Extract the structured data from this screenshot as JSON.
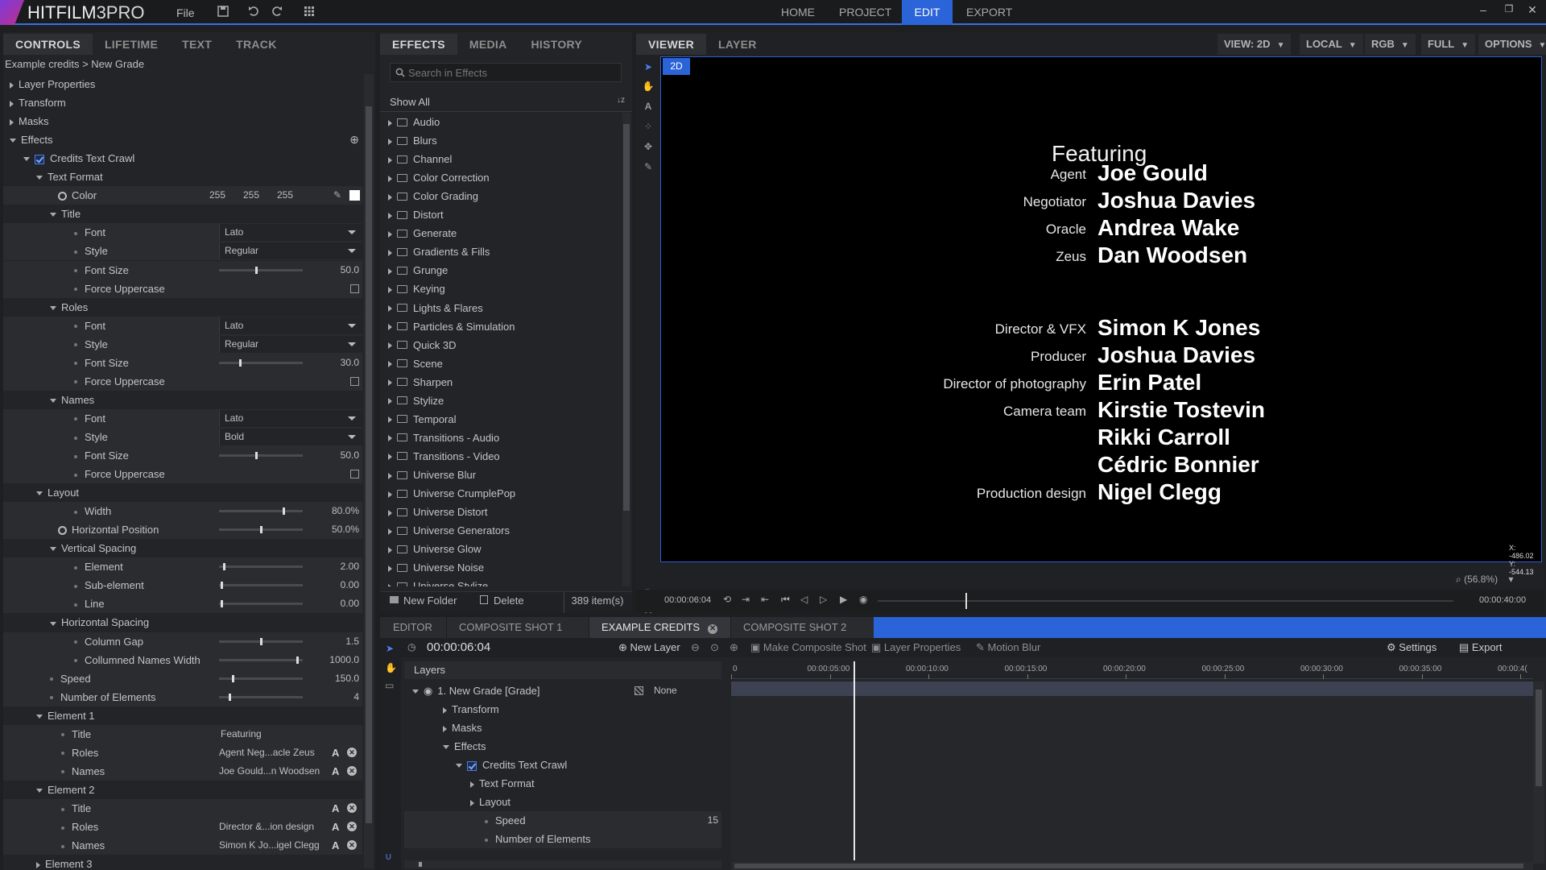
{
  "app": {
    "logo_name": "HITFILM",
    "logo_edition": "3PRO",
    "menu_file": "File"
  },
  "toolbar_icons": [
    "save-icon",
    "undo-icon",
    "redo-icon",
    "grid-icon"
  ],
  "nav": {
    "tabs": [
      "HOME",
      "PROJECT",
      "EDIT",
      "EXPORT"
    ],
    "active": "EDIT"
  },
  "controls_panel": {
    "tabs": [
      "CONTROLS",
      "LIFETIME",
      "TEXT",
      "TRACK"
    ],
    "breadcrumb": "Example credits > New Grade",
    "rows": [
      {
        "label": "Layer Properties"
      },
      {
        "label": "Transform"
      },
      {
        "label": "Masks"
      },
      {
        "label": "Effects"
      },
      {
        "label": "Credits Text Crawl"
      },
      {
        "label": "Text Format"
      },
      {
        "label": "Color",
        "r": "255",
        "g": "255",
        "b": "255"
      },
      {
        "label": "Title"
      },
      {
        "label": "Font",
        "value": "Lato"
      },
      {
        "label": "Style",
        "value": "Regular"
      },
      {
        "label": "Font Size",
        "value": "50.0",
        "level": 0.45
      },
      {
        "label": "Force Uppercase"
      },
      {
        "label": "Roles"
      },
      {
        "label": "Font",
        "value": "Lato"
      },
      {
        "label": "Style",
        "value": "Regular"
      },
      {
        "label": "Font Size",
        "value": "30.0",
        "level": 0.25
      },
      {
        "label": "Force Uppercase"
      },
      {
        "label": "Names"
      },
      {
        "label": "Font",
        "value": "Lato"
      },
      {
        "label": "Style",
        "value": "Bold"
      },
      {
        "label": "Font Size",
        "value": "50.0",
        "level": 0.45
      },
      {
        "label": "Force Uppercase"
      },
      {
        "label": "Layout"
      },
      {
        "label": "Width",
        "value": "80.0%",
        "level": 0.78
      },
      {
        "label": "Horizontal Position",
        "value": "50.0%",
        "level": 0.5
      },
      {
        "label": "Vertical Spacing"
      },
      {
        "label": "Element",
        "value": "2.00",
        "level": 0.05
      },
      {
        "label": "Sub-element",
        "value": "0.00",
        "level": 0.02
      },
      {
        "label": "Line",
        "value": "0.00",
        "level": 0.02
      },
      {
        "label": "Horizontal Spacing"
      },
      {
        "label": "Column Gap",
        "value": "1.5",
        "level": 0.5
      },
      {
        "label": "Collumned Names Width",
        "value": "1000.0",
        "level": 0.95
      },
      {
        "label": "Speed",
        "value": "150.0",
        "level": 0.16
      },
      {
        "label": "Number of Elements",
        "value": "4",
        "level": 0.12
      },
      {
        "label": "Element 1"
      },
      {
        "label": "Title",
        "value": "Featuring"
      },
      {
        "label": "Roles",
        "value": "Agent Neg...acle Zeus"
      },
      {
        "label": "Names",
        "value": "Joe Gould...n Woodsen"
      },
      {
        "label": "Element 2"
      },
      {
        "label": "Title"
      },
      {
        "label": "Roles",
        "value": "Director &...ion design"
      },
      {
        "label": "Names",
        "value": "Simon K Jo...igel Clegg"
      },
      {
        "label": "Element 3"
      }
    ]
  },
  "effects_panel": {
    "tabs": [
      "EFFECTS",
      "MEDIA",
      "HISTORY"
    ],
    "search_placeholder": "Search in Effects",
    "filter": "Show All",
    "folders": [
      "Audio",
      "Blurs",
      "Channel",
      "Color Correction",
      "Color Grading",
      "Distort",
      "Generate",
      "Gradients & Fills",
      "Grunge",
      "Keying",
      "Lights & Flares",
      "Particles & Simulation",
      "Quick 3D",
      "Scene",
      "Sharpen",
      "Stylize",
      "Temporal",
      "Transitions - Audio",
      "Transitions - Video",
      "Universe Blur",
      "Universe CrumplePop",
      "Universe Distort",
      "Universe Generators",
      "Universe Glow",
      "Universe Noise",
      "Universe Stylize"
    ],
    "new_folder": "New Folder",
    "delete": "Delete",
    "count": "389 item(s)"
  },
  "viewer": {
    "tabs": [
      "VIEWER",
      "LAYER"
    ],
    "options": [
      "VIEW: 2D",
      "LOCAL",
      "RGB",
      "FULL",
      "OPTIONS"
    ],
    "mode_badge": "2D",
    "coords": {
      "x_label": "X:",
      "x": "-486.02",
      "y_label": "Y:",
      "y": "-544.13"
    },
    "zoom": "(56.8%)",
    "time_current": "00:00:06:04",
    "time_end": "00:00:40:00",
    "playhead_fraction": 0.153,
    "credits": {
      "heading": "Featuring",
      "lines": [
        {
          "role": "Agent",
          "name": "Joe Gould"
        },
        {
          "role": "Negotiator",
          "name": "Joshua Davies"
        },
        {
          "role": "Oracle",
          "name": "Andrea Wake"
        },
        {
          "role": "Zeus",
          "name": "Dan Woodsen"
        },
        {
          "role": "Director & VFX",
          "name": "Simon K Jones"
        },
        {
          "role": "Producer",
          "name": "Joshua Davies"
        },
        {
          "role": "Director of photography",
          "name": "Erin Patel"
        },
        {
          "role": "Camera team",
          "name": "Kirstie Tostevin"
        },
        {
          "role": "",
          "name": "Rikki Carroll"
        },
        {
          "role": "",
          "name": "Cédric Bonnier"
        },
        {
          "role": "Production design",
          "name": "Nigel Clegg"
        }
      ]
    }
  },
  "timeline": {
    "tabs": [
      "EDITOR",
      "COMPOSITE SHOT 1",
      "EXAMPLE CREDITS",
      "COMPOSITE SHOT 2"
    ],
    "active_tab": "EXAMPLE CREDITS",
    "timecode": "00:00:06:04",
    "buttons": {
      "new_layer": "New Layer",
      "make_composite": "Make Composite Shot",
      "layer_properties": "Layer Properties",
      "motion_blur": "Motion Blur",
      "settings": "Settings",
      "export": "Export"
    },
    "layers_header": "Layers",
    "ruler": [
      "0",
      "00:00:05:00",
      "00:00:10:00",
      "00:00:15:00",
      "00:00:20:00",
      "00:00:25:00",
      "00:00:30:00",
      "00:00:35:00",
      "00:00:4("
    ],
    "layer_rows": [
      {
        "label": "1. New Grade [Grade]",
        "blend": "None"
      },
      {
        "label": "Transform"
      },
      {
        "label": "Masks"
      },
      {
        "label": "Effects"
      },
      {
        "label": "Credits Text Crawl"
      },
      {
        "label": "Text Format"
      },
      {
        "label": "Layout"
      },
      {
        "label": "Speed",
        "value": "15"
      },
      {
        "label": "Number of Elements"
      }
    ]
  }
}
